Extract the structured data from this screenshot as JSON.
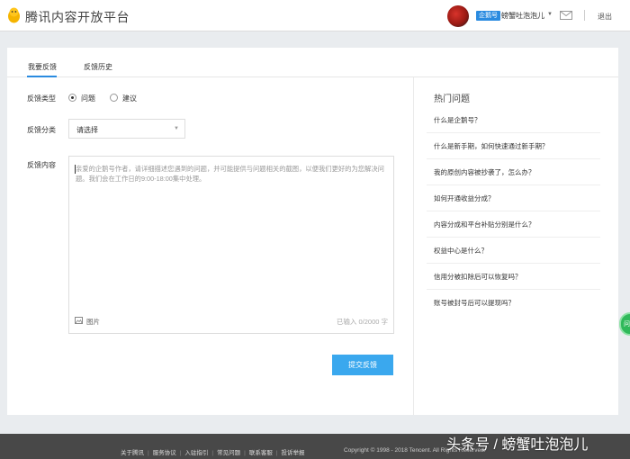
{
  "header": {
    "logo_icon": "penguin-icon",
    "title": "腾讯内容开放平台",
    "badge": "企鹅号",
    "username": "螃蟹吐泡泡儿",
    "logout": "退出"
  },
  "tabs": [
    {
      "label": "我要反馈",
      "active": true
    },
    {
      "label": "反馈历史",
      "active": false
    }
  ],
  "form": {
    "type_label": "反馈类型",
    "type_options": [
      "问题",
      "建议"
    ],
    "type_selected": "问题",
    "category_label": "反馈分类",
    "category_value": "请选择",
    "content_label": "反馈内容",
    "content_placeholder": "亲爱的企鹅号作者，请详细描述您遇到的问题，并可能提供与问题相关的截图，以便我们更好的为您解决问题。我们会在工作日的9:00-18:00集中处理。",
    "image_label": "图片",
    "counter": "已输入 0/2000 字",
    "submit_label": "提交反馈"
  },
  "hot": {
    "title": "热门问题",
    "items": [
      "什么是企鹅号？",
      "什么是新手期，如何快速通过新手期？",
      "我的原创内容被抄袭了，怎么办？",
      "如何开通收益分成？",
      "内容分成和平台补贴分别是什么？",
      "权益中心是什么？",
      "信用分被扣除后可以恢复吗？",
      "账号被封号后可以提现吗？"
    ]
  },
  "side_tab": "问",
  "footer": {
    "links": [
      "关于腾讯",
      "服务协议",
      "入驻指引",
      "常见问题",
      "联系客服",
      "投诉举报"
    ],
    "copyright": "Copyright © 1998 - 2018 Tencent. All Rights Reserved."
  },
  "watermark": "头条号 / 螃蟹吐泡泡儿",
  "colors": {
    "accent": "#2a8be0",
    "submit": "#3aa8ee",
    "footer": "#484848"
  }
}
